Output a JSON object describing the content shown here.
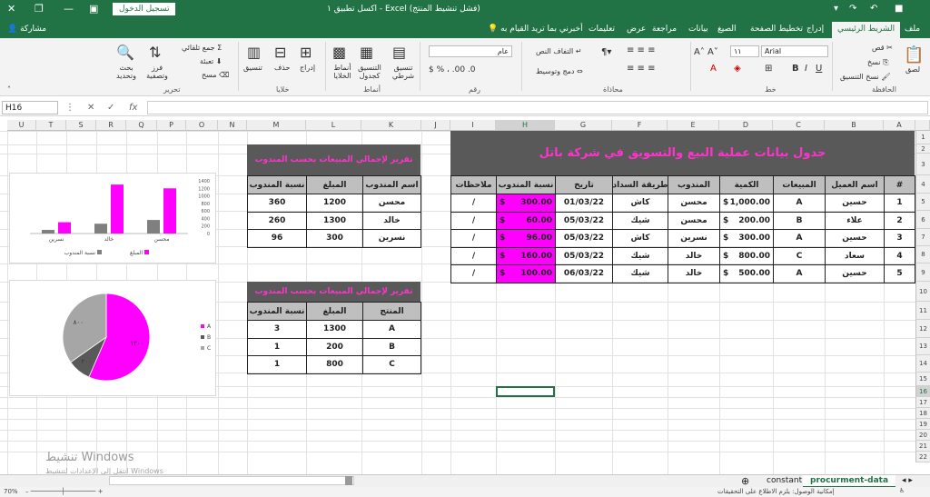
{
  "window": {
    "title": "اكسل تطبيق ١  -  Excel (فشل تنشيط المنتج)",
    "signin": "تسجيل الدخول"
  },
  "ribbon_tabs": [
    "ملف",
    "الشريط الرئيسي",
    "إدراج",
    "تخطيط الصفحة",
    "الصيغ",
    "بيانات",
    "مراجعة",
    "عرض",
    "تعليمات"
  ],
  "tell_me": "أخبرني بما تريد القيام به",
  "share": "مشاركة",
  "ribbon": {
    "clipboard": {
      "label": "الحافظة",
      "paste": "لصق",
      "cut": "قص",
      "copy": "نسخ",
      "format_painter": "نسخ التنسيق"
    },
    "font": {
      "label": "خط",
      "name": "Arial",
      "size": "١١"
    },
    "alignment": {
      "label": "محاذاة",
      "wrap": "التفاف النص",
      "merge": "دمج وتوسيط"
    },
    "number": {
      "label": "رقم",
      "format": "عام"
    },
    "styles": {
      "label": "أنماط",
      "conditional": "تنسيق شرطي",
      "table": "التنسيق كجدول",
      "cell": "أنماط الخلايا"
    },
    "cells": {
      "label": "خلايا",
      "insert": "إدراج",
      "delete": "حذف",
      "format": "تنسيق"
    },
    "editing": {
      "label": "تحرير",
      "autosum": "جمع تلقائي",
      "fill": "تعبئة",
      "clear": "مسح",
      "sort": "فرز وتصفية",
      "find": "بحث وتحديد"
    }
  },
  "formula_bar": {
    "name_box": "H16",
    "fx": "fx",
    "value": ""
  },
  "columns": [
    "A",
    "B",
    "C",
    "D",
    "E",
    "F",
    "G",
    "H",
    "I",
    "J",
    "K",
    "L",
    "M",
    "N",
    "O",
    "P",
    "Q",
    "R",
    "S",
    "T",
    "U"
  ],
  "rows": [
    "1",
    "2",
    "3",
    "4",
    "5",
    "6",
    "7",
    "8",
    "9",
    "10",
    "11",
    "12",
    "13",
    "14",
    "15",
    "16",
    "17",
    "18",
    "19",
    "20",
    "21",
    "22"
  ],
  "main_table": {
    "title": "جدول بيانات عملية البيع والتسويق في شركة باتل",
    "headers": [
      "#",
      "اسم العميل",
      "المبيعات",
      "الكمية",
      "المندوب",
      "طريقة السداد",
      "تاريخ",
      "نسبة المندوب",
      "ملاحظات"
    ],
    "rows": [
      {
        "n": "1",
        "client": "حسين",
        "sales": "A",
        "cur": "$",
        "qty": "1,000.00",
        "rep": "محسن",
        "pay": "كاش",
        "date": "01/03/22",
        "rcur": "$",
        "rate": "300.00",
        "note": "/"
      },
      {
        "n": "2",
        "client": "علاء",
        "sales": "B",
        "cur": "$",
        "qty": "200.00",
        "rep": "محسن",
        "pay": "شيك",
        "date": "05/03/22",
        "rcur": "$",
        "rate": "60.00",
        "note": "/"
      },
      {
        "n": "3",
        "client": "حسين",
        "sales": "A",
        "cur": "$",
        "qty": "300.00",
        "rep": "نسرين",
        "pay": "كاش",
        "date": "05/03/22",
        "rcur": "$",
        "rate": "96.00",
        "note": "/"
      },
      {
        "n": "4",
        "client": "سعاد",
        "sales": "C",
        "cur": "$",
        "qty": "800.00",
        "rep": "خالد",
        "pay": "شيك",
        "date": "05/03/22",
        "rcur": "$",
        "rate": "160.00",
        "note": "/"
      },
      {
        "n": "5",
        "client": "حسين",
        "sales": "A",
        "cur": "$",
        "qty": "500.00",
        "rep": "خالد",
        "pay": "شيك",
        "date": "06/03/22",
        "rcur": "$",
        "rate": "100.00",
        "note": "/"
      }
    ]
  },
  "report_reps": {
    "title": "تقرير لإجمالي المبيعات بحسب المندوب",
    "headers": [
      "اسم المندوب",
      "المبلغ",
      "نسبة المندوب"
    ],
    "rows": [
      [
        "محسن",
        "1200",
        "360"
      ],
      [
        "خالد",
        "1300",
        "260"
      ],
      [
        "نسرين",
        "300",
        "96"
      ]
    ]
  },
  "report_products": {
    "title": "تقرير لإجمالي المبيعات بحسب المندوب",
    "headers": [
      "المنتج",
      "المبلغ",
      "نسبة المندوب"
    ],
    "rows": [
      [
        "A",
        "1300",
        "3"
      ],
      [
        "B",
        "200",
        "1"
      ],
      [
        "C",
        "800",
        "1"
      ]
    ]
  },
  "chart_data": [
    {
      "type": "bar",
      "categories": [
        "محسن",
        "خالد",
        "نسرين"
      ],
      "series": [
        {
          "name": "المبلغ",
          "values": [
            1200,
            1300,
            300
          ],
          "color": "#ff00ff"
        },
        {
          "name": "نسبة المندوب",
          "values": [
            360,
            260,
            96
          ],
          "color": "#7f7f7f"
        }
      ],
      "ylim": [
        0,
        1400
      ],
      "yticks": [
        "0",
        "200",
        "400",
        "600",
        "800",
        "1000",
        "1200",
        "1400"
      ],
      "legend": "bottom",
      "grid": false
    },
    {
      "type": "pie",
      "categories": [
        "A",
        "B",
        "C"
      ],
      "values": [
        1300,
        200,
        800
      ],
      "data_labels": [
        "١٣٠٠",
        "٢٠٠",
        "٨٠٠"
      ],
      "colors": [
        "#ff00ff",
        "#595959",
        "#a6a6a6"
      ],
      "legend": "right"
    }
  ],
  "sheets": {
    "tabs": [
      "procurment-data",
      "constant"
    ],
    "active": "procurment-data"
  },
  "status": {
    "zoom": "70%",
    "accessibility": "إمكانية الوصول: يلزم الاطلاع على التحقيقات"
  },
  "watermark": {
    "line1": "تنشيط Windows",
    "line2": "انتقل إلى الإعدادات لتنشيط Windows"
  }
}
